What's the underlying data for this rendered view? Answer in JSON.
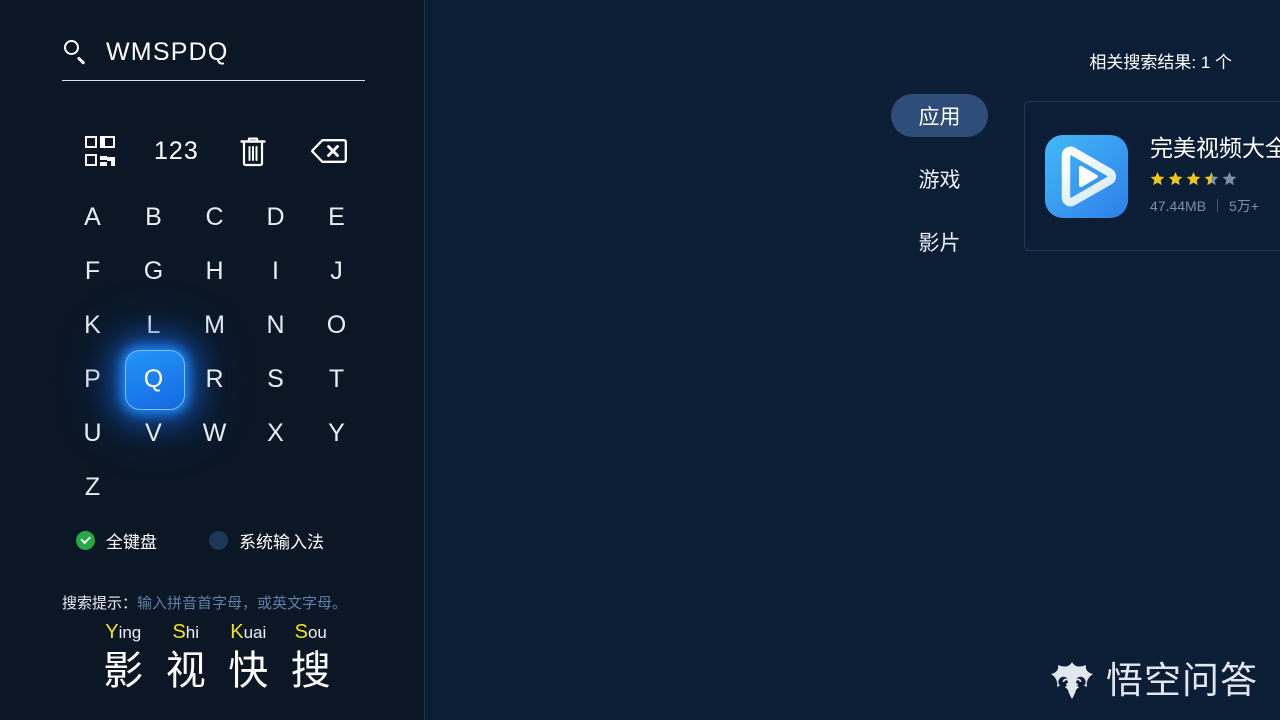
{
  "search": {
    "icon": "search-icon",
    "value": "WMSPDQ",
    "placeholder": ""
  },
  "keyboard": {
    "tools": [
      {
        "name": "qr-code-icon",
        "label": ""
      },
      {
        "name": "numeric-mode-button",
        "label": "123"
      },
      {
        "name": "clear-all-icon",
        "label": ""
      },
      {
        "name": "backspace-icon",
        "label": ""
      }
    ],
    "keys": [
      "A",
      "B",
      "C",
      "D",
      "E",
      "F",
      "G",
      "H",
      "I",
      "J",
      "K",
      "L",
      "M",
      "N",
      "O",
      "P",
      "Q",
      "R",
      "S",
      "T",
      "U",
      "V",
      "W",
      "X",
      "Y",
      "Z"
    ],
    "selected_key": "Q",
    "modes": [
      {
        "label": "全键盘",
        "checked": true
      },
      {
        "label": "系统输入法",
        "checked": false
      }
    ]
  },
  "hint": {
    "label": "搜索提示：",
    "text": "输入拼音首字母，或英文字母。"
  },
  "brand": {
    "pinyin": [
      {
        "initial": "Y",
        "rest": "ing"
      },
      {
        "initial": "S",
        "rest": "hi"
      },
      {
        "initial": "K",
        "rest": "uai"
      },
      {
        "initial": "S",
        "rest": "ou"
      }
    ],
    "chars": [
      "影",
      "视",
      "快",
      "搜"
    ]
  },
  "results": {
    "count_label": "相关搜索结果: 1 个",
    "tabs": [
      {
        "label": "应用",
        "active": true
      },
      {
        "label": "游戏",
        "active": false
      },
      {
        "label": "影片",
        "active": false
      }
    ],
    "items": [
      {
        "title": "完美视频大全",
        "icon": "play-button-app-icon",
        "rating": 3.5,
        "size": "47.44MB",
        "downloads": "5万+"
      }
    ]
  },
  "watermark": {
    "icon": "wukong-mask-icon",
    "text": "悟空问答"
  },
  "colors": {
    "left_bg": "#0b1725",
    "right_bg": "#0c1e36",
    "accent_blue": "#1668e3",
    "key_glow": "#218cff",
    "tab_active": "#2e4d78",
    "star_gold": "#f0c419",
    "star_empty": "#7d8fa4",
    "radio_on": "#28a745",
    "radio_off": "#1d3756",
    "pinyin_initial": "#f3e21c",
    "hint_muted": "#5f7fa8",
    "meta_muted": "#7d8fa4"
  }
}
